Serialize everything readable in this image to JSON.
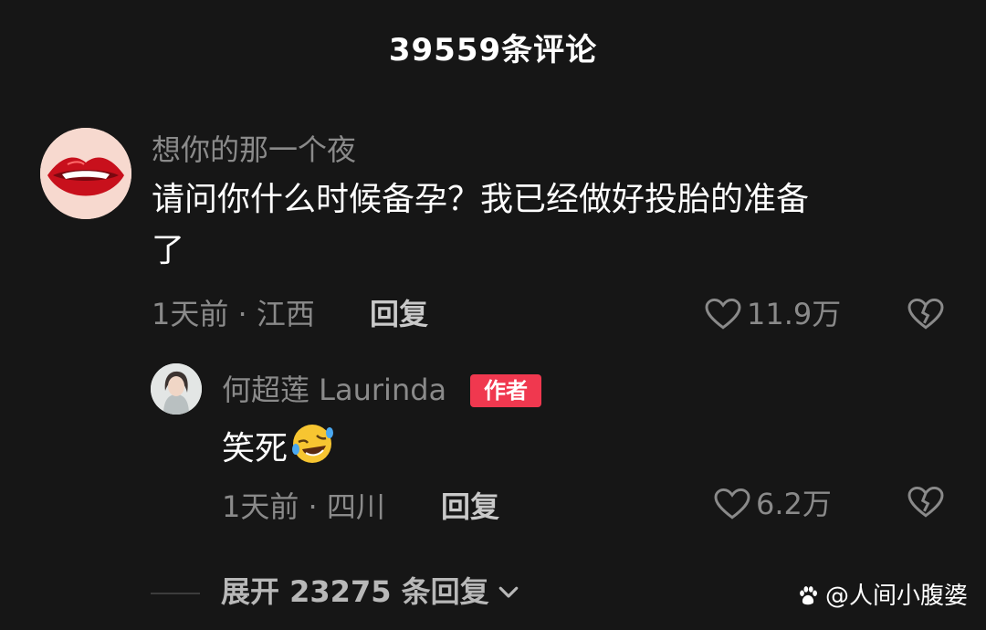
{
  "header": {
    "title": "39559条评论"
  },
  "comment": {
    "username": "想你的那一个夜",
    "text_line1": "请问你什么时候备孕？我已经做好投胎的准备",
    "text_line2": "了",
    "time_location": "1天前 · 江西",
    "reply_label": "回复",
    "like_count": "11.9万",
    "avatar_icon": "red-lips-avatar"
  },
  "reply": {
    "username": "何超莲 Laurinda",
    "author_badge": "作者",
    "text": "笑死",
    "emoji": "rolling-laughing-emoji",
    "time_location": "1天前 · 四川",
    "reply_label": "回复",
    "like_count": "6.2万",
    "avatar_icon": "woman-portrait-avatar"
  },
  "expand": {
    "label": "展开 23275 条回复"
  },
  "watermark": {
    "text": "@人间小腹婆",
    "icon": "paw-icon"
  },
  "colors": {
    "background": "#161616",
    "muted_text": "#8a8a8a",
    "badge": "#f0384f"
  }
}
